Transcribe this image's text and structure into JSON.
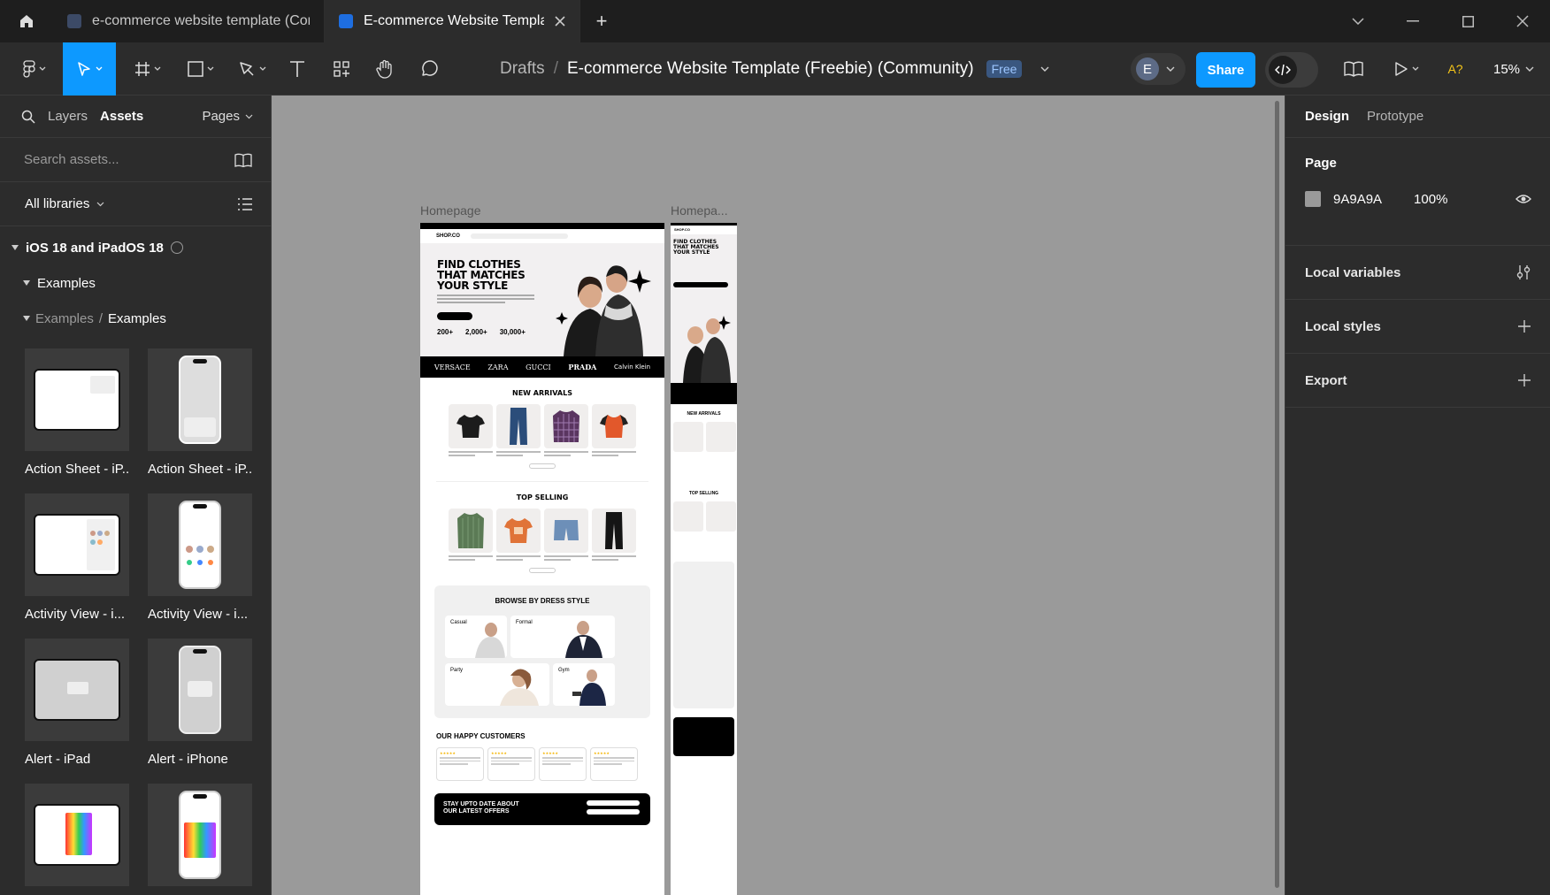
{
  "titlebar": {
    "tabs": [
      {
        "label": "e-commerce website template (Com",
        "active": false
      },
      {
        "label": "E-commerce Website Template (Fr",
        "active": true
      }
    ],
    "new_tab": "+"
  },
  "toolbar": {
    "breadcrumb_parent": "Drafts",
    "breadcrumb_sep": "/",
    "file_name": "E-commerce Website Template (Freebie) (Community)",
    "badge": "Free",
    "avatar_initial": "E",
    "share_label": "Share",
    "ai_label": "A?",
    "zoom": "15%"
  },
  "left_panel": {
    "tab_layers": "Layers",
    "tab_assets": "Assets",
    "pages_label": "Pages",
    "search_placeholder": "Search assets...",
    "libraries_label": "All libraries",
    "library_name": "iOS 18 and iPadOS 18",
    "group_examples": "Examples",
    "sub_path_parent": "Examples",
    "sub_path_sep": "/",
    "sub_path_child": "Examples",
    "assets": [
      {
        "label": "Action Sheet - iP..."
      },
      {
        "label": "Action Sheet - iP..."
      },
      {
        "label": "Activity View - i..."
      },
      {
        "label": "Activity View - i..."
      },
      {
        "label": "Alert - iPad"
      },
      {
        "label": "Alert - iPhone"
      },
      {
        "label": ""
      },
      {
        "label": ""
      }
    ]
  },
  "canvas": {
    "background": "#9A9A9A",
    "frames": [
      {
        "label": "Homepage"
      },
      {
        "label": "Homepa..."
      }
    ],
    "mock": {
      "logo": "SHOP.CO",
      "hero_title": "FIND CLOTHES THAT MATCHES YOUR STYLE",
      "stats": [
        "200+",
        "2,000+",
        "30,000+"
      ],
      "brands": [
        "VERSACE",
        "ZARA",
        "GUCCI",
        "PRADA",
        "Calvin Klein"
      ],
      "new_arrivals": "NEW ARRIVALS",
      "top_selling": "TOP SELLING",
      "browse": "BROWSE BY DRESS STYLE",
      "styles": [
        "Casual",
        "Formal",
        "Party",
        "Gym"
      ],
      "customers": "OUR HAPPY CUSTOMERS",
      "newsletter": "STAY UPTO DATE ABOUT OUR LATEST OFFERS"
    }
  },
  "right_panel": {
    "tab_design": "Design",
    "tab_prototype": "Prototype",
    "page_title": "Page",
    "page_color": "9A9A9A",
    "page_opacity": "100%",
    "local_variables": "Local variables",
    "local_styles": "Local styles",
    "export": "Export"
  }
}
